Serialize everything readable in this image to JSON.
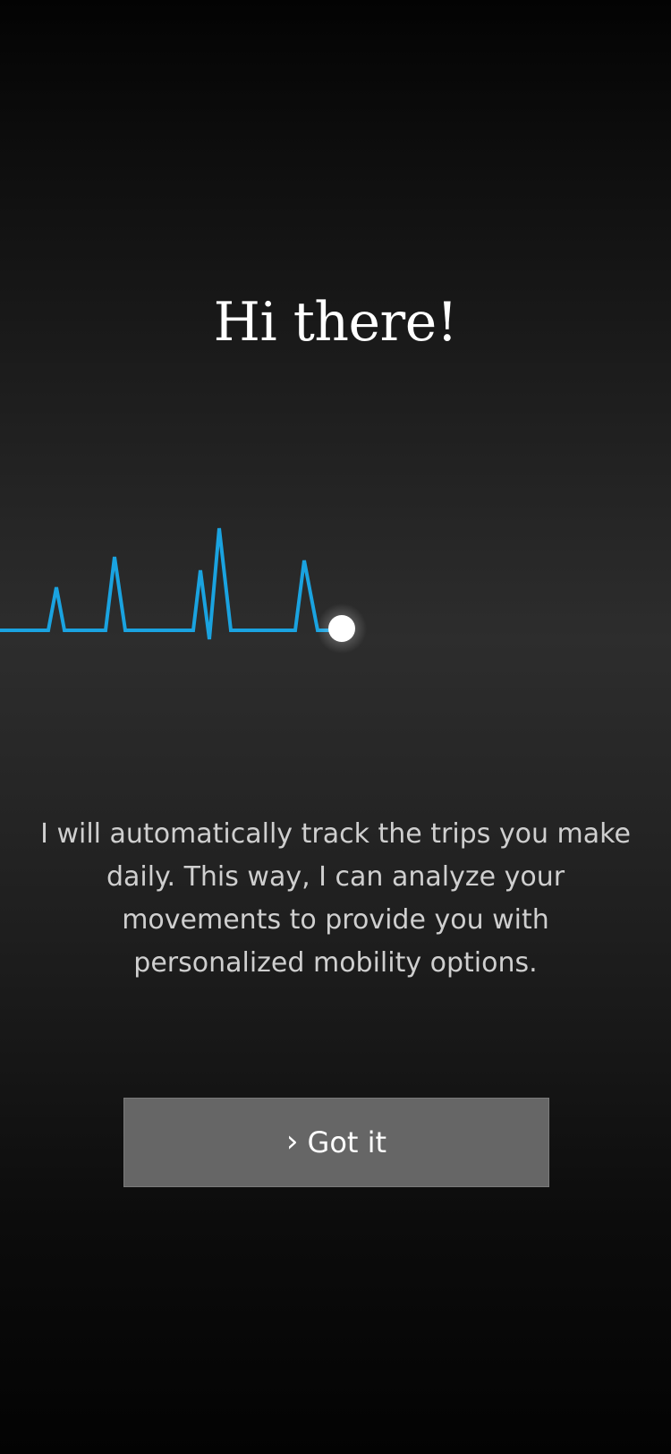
{
  "onboarding": {
    "title": "Hi there!",
    "description": "I will automatically track the trips you make daily. This way, I can analyze your movements to provide you with personalized mobility options.",
    "primary_button": {
      "icon": "chevron-right-icon",
      "icon_glyph": "›",
      "label": "Got it"
    }
  },
  "colors": {
    "background_dark": "#030303",
    "background_mid": "#2d2d2d",
    "pulse_line": "#1aa3e0",
    "pulse_dot": "#ffffff",
    "text_primary": "#ffffff",
    "text_secondary": "#cfcfcf",
    "button_fill": "#666666"
  }
}
